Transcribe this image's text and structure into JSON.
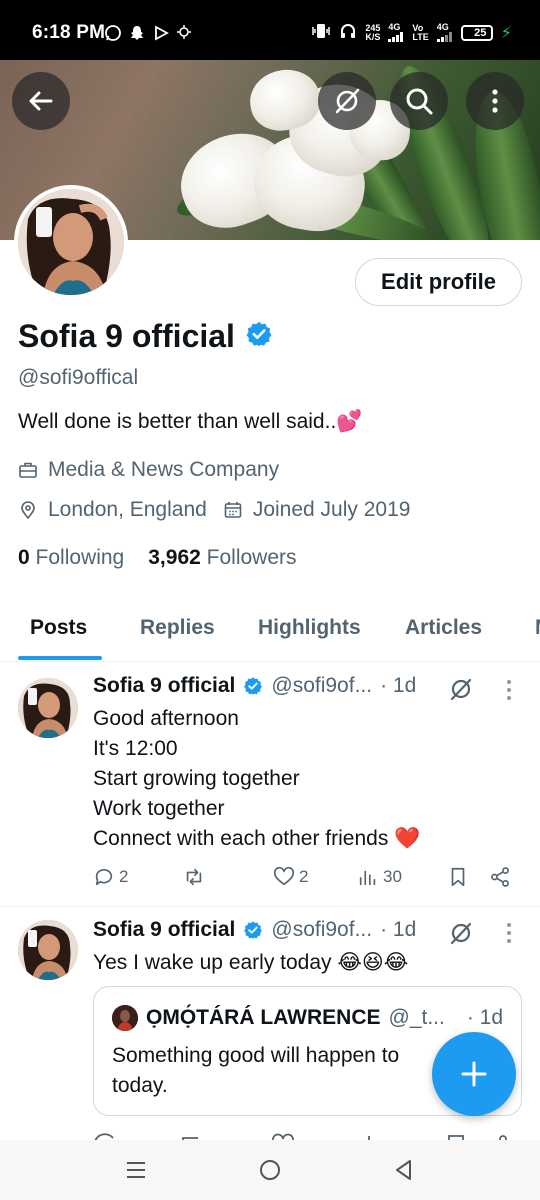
{
  "status_bar": {
    "time": "6:18 PM",
    "speed_value": "245",
    "speed_unit": "K/S",
    "net1": "4G",
    "net2_top": "Vo",
    "net2_bottom": "LTE",
    "net3": "4G",
    "battery": "25",
    "battery_level": 0.25
  },
  "profile": {
    "display_name": "Sofia 9 official",
    "handle": "@sofi9offical",
    "bio": "Well done is better than well said..💕",
    "category": "Media & News Company",
    "location": "London, England",
    "joined": "Joined July 2019",
    "following_count": "0",
    "following_label": "Following",
    "followers_count": "3,962",
    "followers_label": "Followers",
    "edit_button": "Edit profile"
  },
  "tabs": [
    {
      "label": "Posts",
      "active": true
    },
    {
      "label": "Replies",
      "active": false
    },
    {
      "label": "Highlights",
      "active": false
    },
    {
      "label": "Articles",
      "active": false
    },
    {
      "label": "M",
      "active": false
    }
  ],
  "posts": [
    {
      "name": "Sofia 9 official",
      "handle": "@sofi9of...",
      "time": "· 1d",
      "text": "Good afternoon\nIt's 12:00\nStart growing together\nWork together\nConnect with each other friends ❤️",
      "replies": "2",
      "reposts": "",
      "likes": "2",
      "views": "30"
    },
    {
      "name": "Sofia 9 official",
      "handle": "@sofi9of...",
      "time": "· 1d",
      "text": "Yes I wake up early today 😂😆😂",
      "quote": {
        "name": "ỌMỌ́TÁRÁ LAWRENCE",
        "handle": "@_t...",
        "time": "· 1d",
        "text": "Something good will happen to\ntoday."
      }
    }
  ],
  "colors": {
    "accent": "#1d9bf0",
    "text_primary": "#0f1419",
    "text_secondary": "#536471",
    "border": "#cfd9de",
    "like_red": "#e0245e"
  },
  "icons": {
    "back": "back-arrow-icon",
    "grok": "grok-icon",
    "search": "search-icon",
    "more": "more-vertical-icon",
    "verified": "verified-badge-icon",
    "category": "briefcase-icon",
    "location": "location-pin-icon",
    "calendar": "calendar-icon",
    "reply": "reply-icon",
    "repost": "repost-icon",
    "like": "heart-icon",
    "views": "views-icon",
    "bookmark": "bookmark-icon",
    "share": "share-icon",
    "compose": "plus-icon"
  }
}
